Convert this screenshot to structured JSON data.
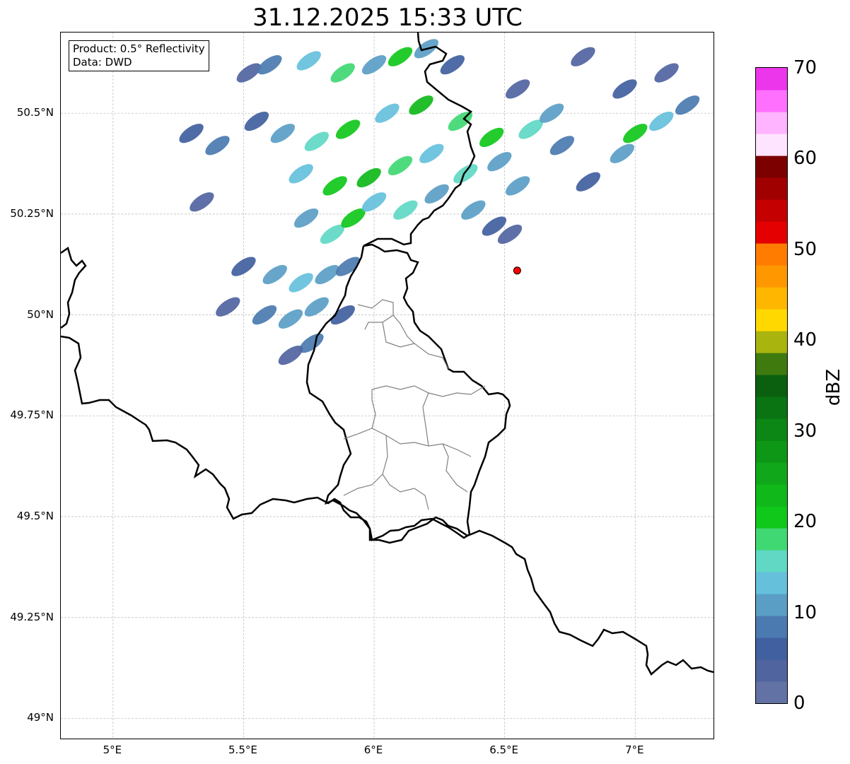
{
  "title": "31.12.2025 15:33 UTC",
  "info": {
    "line1": "Product: 0.5° Reflectivity",
    "line2": "Data: DWD"
  },
  "axes": {
    "lon_range": [
      4.8,
      7.3
    ],
    "lat_range": [
      48.95,
      50.7
    ],
    "lon_ticks": [
      {
        "value": 5.0,
        "label": "5°E"
      },
      {
        "value": 5.5,
        "label": "5.5°E"
      },
      {
        "value": 6.0,
        "label": "6°E"
      },
      {
        "value": 6.5,
        "label": "6.5°E"
      },
      {
        "value": 7.0,
        "label": "7°E"
      }
    ],
    "lat_ticks": [
      {
        "value": 50.5,
        "label": "50.5°N"
      },
      {
        "value": 50.25,
        "label": "50.25°N"
      },
      {
        "value": 50.0,
        "label": "50°N"
      },
      {
        "value": 49.75,
        "label": "49.75°N"
      },
      {
        "value": 49.5,
        "label": "49.5°N"
      },
      {
        "value": 49.25,
        "label": "49.25°N"
      },
      {
        "value": 49.0,
        "label": "49°N"
      }
    ],
    "grid": true
  },
  "radar_site": {
    "lon": 6.548,
    "lat": 50.11,
    "color": "#ff0000"
  },
  "colorbar": {
    "label": "dBZ",
    "min": 0,
    "max": 70,
    "tick_labels": [
      {
        "value": 0,
        "label": "0"
      },
      {
        "value": 10,
        "label": "10"
      },
      {
        "value": 20,
        "label": "20"
      },
      {
        "value": 30,
        "label": "30"
      },
      {
        "value": 40,
        "label": "40"
      },
      {
        "value": 50,
        "label": "50"
      },
      {
        "value": 60,
        "label": "60"
      },
      {
        "value": 70,
        "label": "70"
      }
    ],
    "colors": [
      "#6272a4",
      "#5064a0",
      "#4060a0",
      "#4a7ab0",
      "#5a9ec6",
      "#65c0dc",
      "#60d8c4",
      "#40d872",
      "#10c81a",
      "#10b81a",
      "#10a81a",
      "#0e9616",
      "#0c8614",
      "#0a7412",
      "#0a600e",
      "#3e7a0e",
      "#aab40e",
      "#ffd800",
      "#ffb600",
      "#ff9800",
      "#ff7c00",
      "#e40000",
      "#c40000",
      "#a00000",
      "#7c0000",
      "#ffe4ff",
      "#ffb4ff",
      "#ff70ff",
      "#ec36ec"
    ]
  },
  "reflectivity_cells": [
    {
      "lon": 5.52,
      "lat": 50.6,
      "dbz": 4
    },
    {
      "lon": 5.6,
      "lat": 50.62,
      "dbz": 8
    },
    {
      "lon": 5.75,
      "lat": 50.63,
      "dbz": 14
    },
    {
      "lon": 5.88,
      "lat": 50.6,
      "dbz": 18
    },
    {
      "lon": 6.0,
      "lat": 50.62,
      "dbz": 12
    },
    {
      "lon": 6.1,
      "lat": 50.64,
      "dbz": 20
    },
    {
      "lon": 6.2,
      "lat": 50.66,
      "dbz": 10
    },
    {
      "lon": 6.3,
      "lat": 50.62,
      "dbz": 6
    },
    {
      "lon": 6.55,
      "lat": 50.56,
      "dbz": 4
    },
    {
      "lon": 5.55,
      "lat": 50.48,
      "dbz": 6
    },
    {
      "lon": 5.65,
      "lat": 50.45,
      "dbz": 12
    },
    {
      "lon": 5.78,
      "lat": 50.43,
      "dbz": 16
    },
    {
      "lon": 5.9,
      "lat": 50.46,
      "dbz": 20
    },
    {
      "lon": 6.05,
      "lat": 50.5,
      "dbz": 14
    },
    {
      "lon": 6.18,
      "lat": 50.52,
      "dbz": 22
    },
    {
      "lon": 6.33,
      "lat": 50.48,
      "dbz": 18
    },
    {
      "lon": 6.45,
      "lat": 50.44,
      "dbz": 20
    },
    {
      "lon": 6.6,
      "lat": 50.46,
      "dbz": 16
    },
    {
      "lon": 6.68,
      "lat": 50.5,
      "dbz": 12
    },
    {
      "lon": 6.72,
      "lat": 50.42,
      "dbz": 8
    },
    {
      "lon": 6.82,
      "lat": 50.33,
      "dbz": 6
    },
    {
      "lon": 5.72,
      "lat": 50.35,
      "dbz": 14
    },
    {
      "lon": 5.85,
      "lat": 50.32,
      "dbz": 20
    },
    {
      "lon": 5.98,
      "lat": 50.34,
      "dbz": 24
    },
    {
      "lon": 6.1,
      "lat": 50.37,
      "dbz": 18
    },
    {
      "lon": 6.22,
      "lat": 50.4,
      "dbz": 14
    },
    {
      "lon": 6.35,
      "lat": 50.35,
      "dbz": 16
    },
    {
      "lon": 6.48,
      "lat": 50.38,
      "dbz": 12
    },
    {
      "lon": 6.55,
      "lat": 50.32,
      "dbz": 10
    },
    {
      "lon": 5.74,
      "lat": 50.24,
      "dbz": 10
    },
    {
      "lon": 5.84,
      "lat": 50.2,
      "dbz": 16
    },
    {
      "lon": 5.92,
      "lat": 50.24,
      "dbz": 20
    },
    {
      "lon": 6.0,
      "lat": 50.28,
      "dbz": 14
    },
    {
      "lon": 6.12,
      "lat": 50.26,
      "dbz": 16
    },
    {
      "lon": 6.24,
      "lat": 50.3,
      "dbz": 10
    },
    {
      "lon": 6.38,
      "lat": 50.26,
      "dbz": 12
    },
    {
      "lon": 6.46,
      "lat": 50.22,
      "dbz": 6
    },
    {
      "lon": 6.52,
      "lat": 50.2,
      "dbz": 4
    },
    {
      "lon": 5.5,
      "lat": 50.12,
      "dbz": 6
    },
    {
      "lon": 5.62,
      "lat": 50.1,
      "dbz": 10
    },
    {
      "lon": 5.72,
      "lat": 50.08,
      "dbz": 14
    },
    {
      "lon": 5.82,
      "lat": 50.1,
      "dbz": 12
    },
    {
      "lon": 5.9,
      "lat": 50.12,
      "dbz": 8
    },
    {
      "lon": 5.44,
      "lat": 50.02,
      "dbz": 4
    },
    {
      "lon": 5.58,
      "lat": 50.0,
      "dbz": 8
    },
    {
      "lon": 5.68,
      "lat": 49.99,
      "dbz": 10
    },
    {
      "lon": 5.78,
      "lat": 50.02,
      "dbz": 12
    },
    {
      "lon": 5.88,
      "lat": 50.0,
      "dbz": 6
    },
    {
      "lon": 5.76,
      "lat": 49.93,
      "dbz": 8
    },
    {
      "lon": 5.68,
      "lat": 49.9,
      "dbz": 4
    },
    {
      "lon": 5.34,
      "lat": 50.28,
      "dbz": 4
    },
    {
      "lon": 5.3,
      "lat": 50.45,
      "dbz": 6
    },
    {
      "lon": 5.4,
      "lat": 50.42,
      "dbz": 8
    },
    {
      "lon": 7.0,
      "lat": 50.45,
      "dbz": 20
    },
    {
      "lon": 7.1,
      "lat": 50.48,
      "dbz": 14
    },
    {
      "lon": 7.2,
      "lat": 50.52,
      "dbz": 8
    },
    {
      "lon": 6.96,
      "lat": 50.56,
      "dbz": 6
    },
    {
      "lon": 7.12,
      "lat": 50.6,
      "dbz": 4
    },
    {
      "lon": 6.95,
      "lat": 50.4,
      "dbz": 10
    },
    {
      "lon": 6.8,
      "lat": 50.64,
      "dbz": 4
    }
  ]
}
